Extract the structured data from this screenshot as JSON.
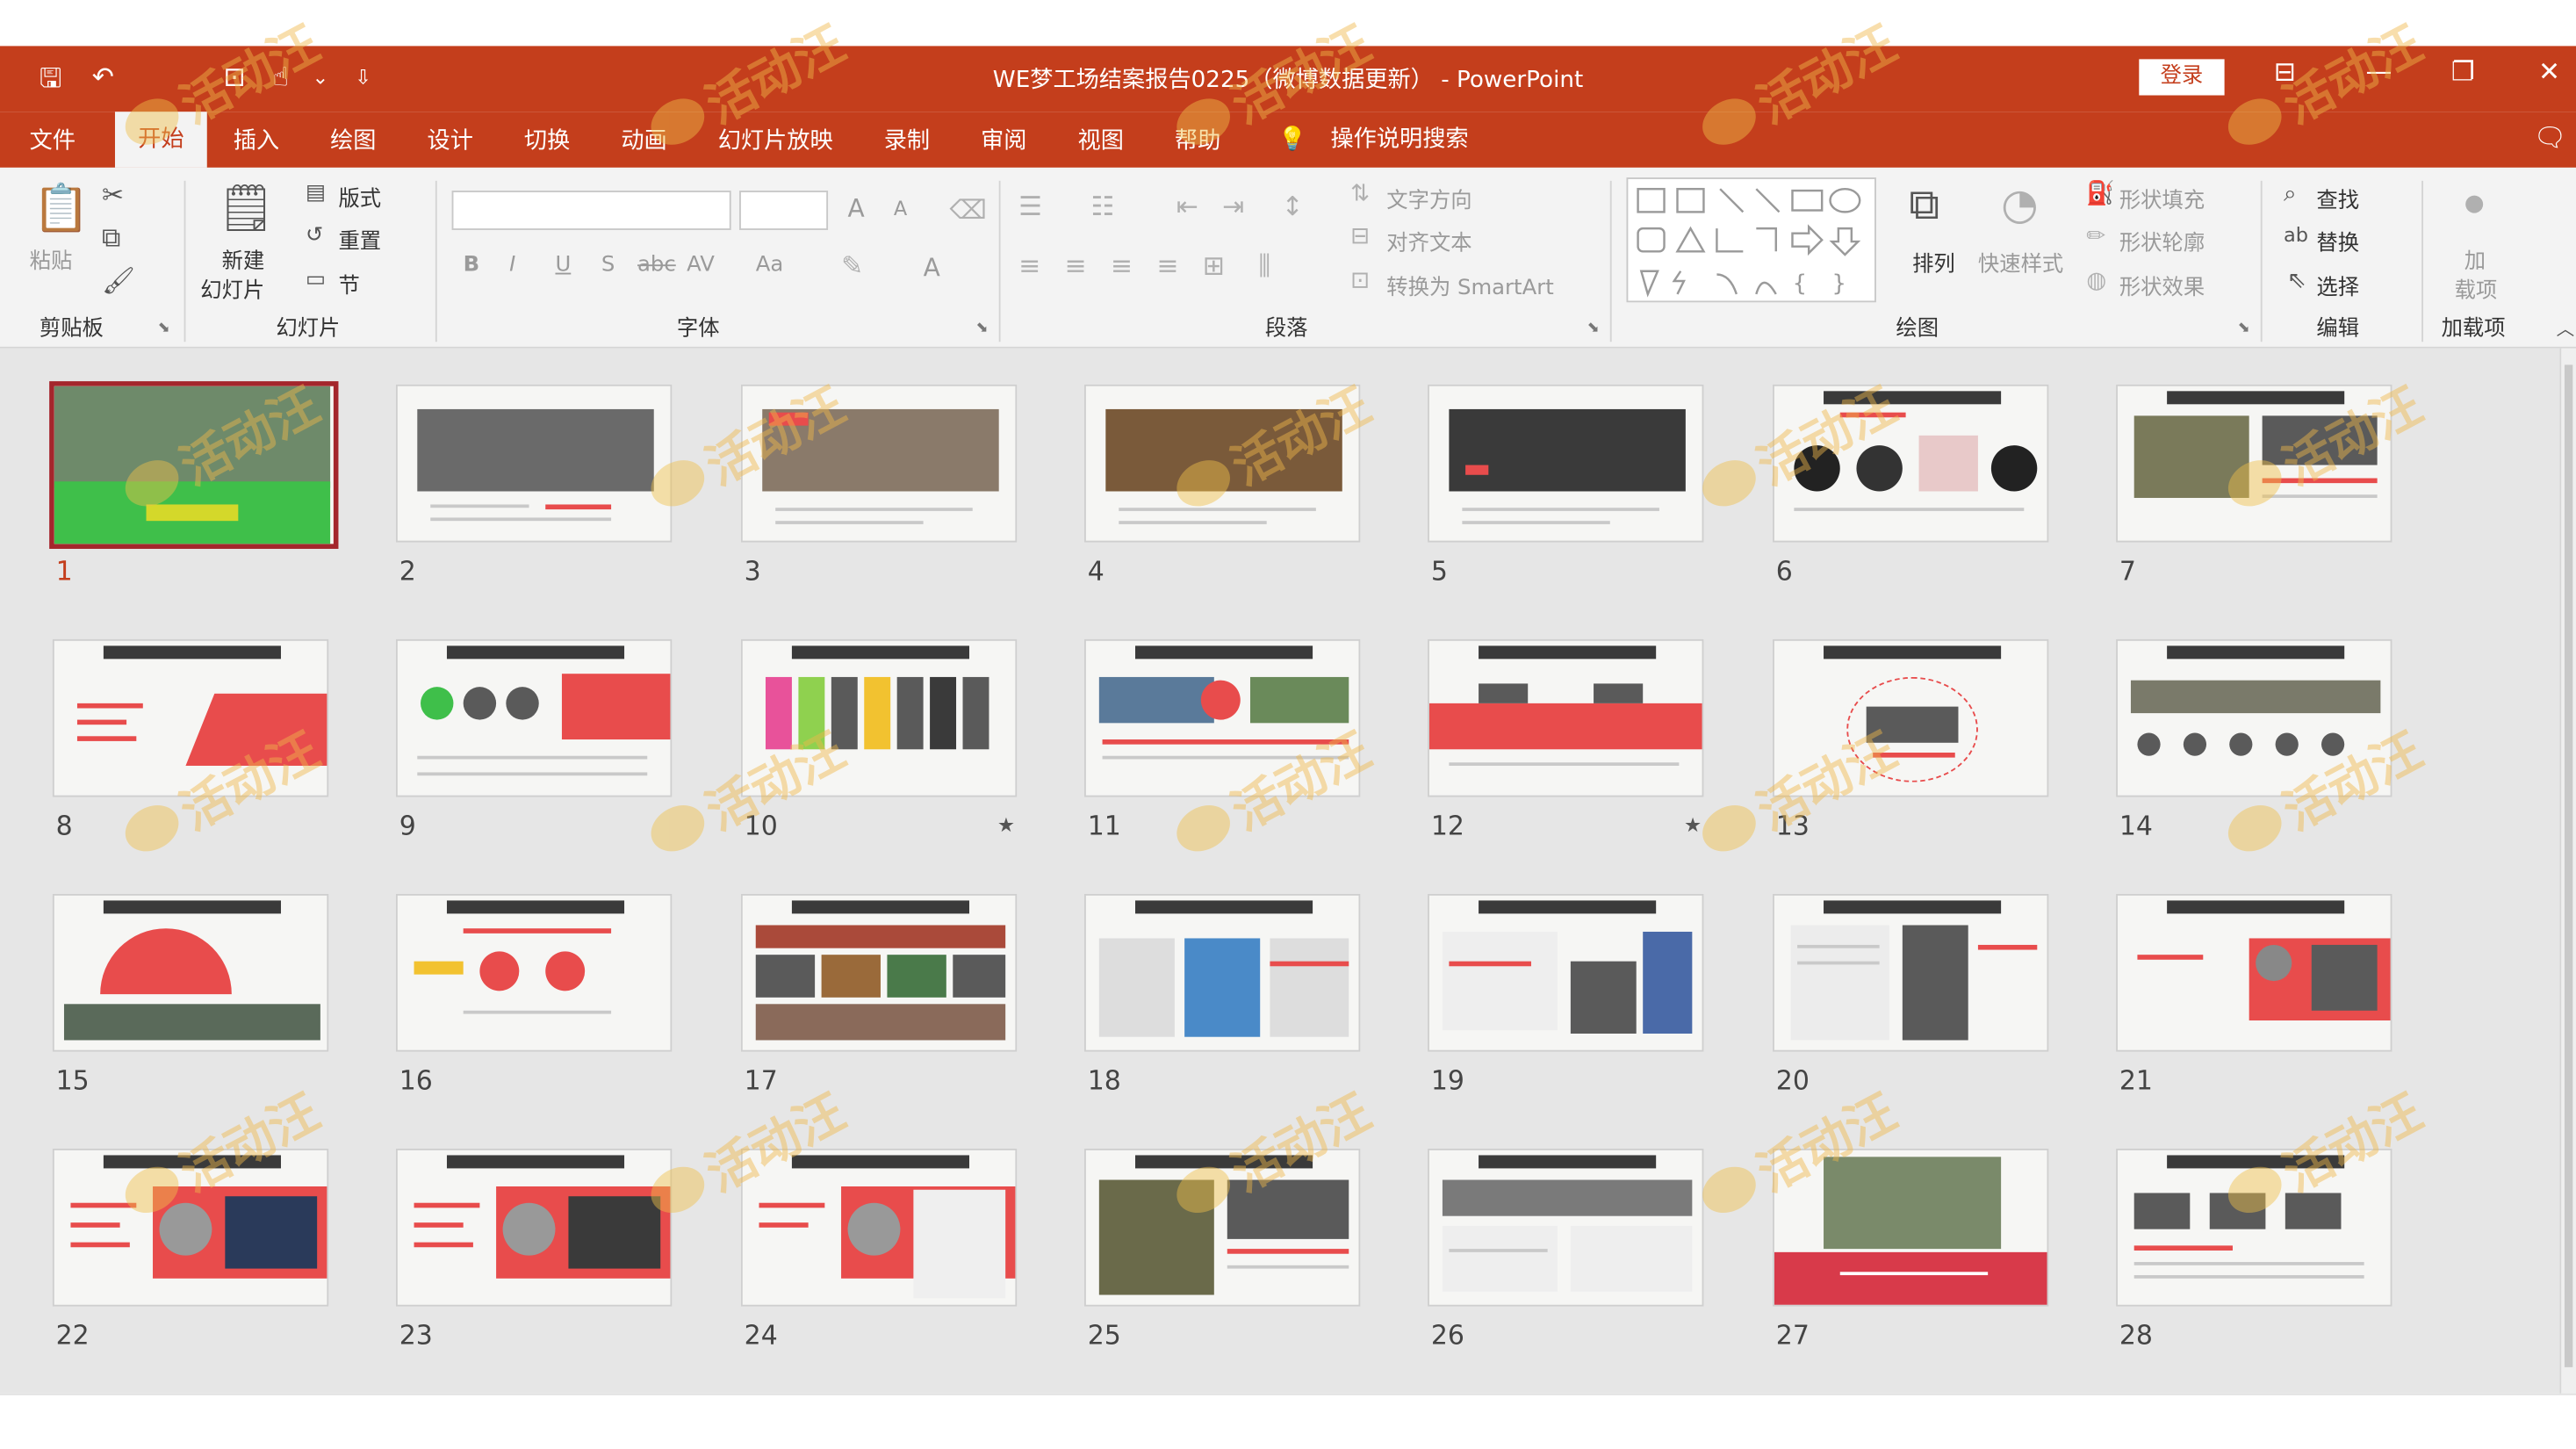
{
  "window": {
    "title": "WE梦工场结案报告0225（微博数据更新） - PowerPoint",
    "login_label": "登录",
    "minimize": "—",
    "restore": "❐",
    "close": "✕"
  },
  "quick_access": {
    "save": "🖫",
    "undo": "↶",
    "present": "⊡",
    "touch": "☝",
    "more": "⌄",
    "customize": "⇩"
  },
  "tabs": [
    "文件",
    "开始",
    "插入",
    "绘图",
    "设计",
    "切换",
    "动画",
    "幻灯片放映",
    "录制",
    "审阅",
    "视图",
    "帮助"
  ],
  "active_tab": "开始",
  "tell_me": "操作说明搜索",
  "ribbon": {
    "clipboard": {
      "label": "剪贴板",
      "paste": "粘贴"
    },
    "slides": {
      "label": "幻灯片",
      "new_slide_1": "新建",
      "new_slide_2": "幻灯片",
      "layout": "版式",
      "reset": "重置",
      "section": "节"
    },
    "font": {
      "label": "字体",
      "bold": "B",
      "italic": "I",
      "underline": "U",
      "shadow": "S",
      "strike": "abc",
      "spacing": "AV",
      "case": "Aa",
      "grow": "A",
      "shrink": "A",
      "color": "A"
    },
    "paragraph": {
      "label": "段落",
      "text_direction": "文字方向",
      "align_text": "对齐文本",
      "smartart": "转换为 SmartArt"
    },
    "drawing": {
      "label": "绘图",
      "arrange": "排列",
      "quick_styles": "快速样式",
      "shape_fill": "形状填充",
      "shape_outline": "形状轮廓",
      "shape_effects": "形状效果"
    },
    "editing": {
      "label": "编辑",
      "find": "查找",
      "replace": "替换",
      "select": "选择"
    },
    "addins": {
      "label": "加载项",
      "addin_1": "加",
      "addin_2": "载项"
    }
  },
  "slides": [
    "1",
    "2",
    "3",
    "4",
    "5",
    "6",
    "7",
    "8",
    "9",
    "10",
    "11",
    "12",
    "13",
    "14",
    "15",
    "16",
    "17",
    "18",
    "19",
    "20",
    "21",
    "22",
    "23",
    "24",
    "25",
    "26",
    "27",
    "28"
  ],
  "selected_slide": "1",
  "watermark": "活动汪",
  "colors": {
    "accent": "#c43e1c",
    "slide_red": "#e84c4c",
    "selected_border": "#a4262c"
  }
}
